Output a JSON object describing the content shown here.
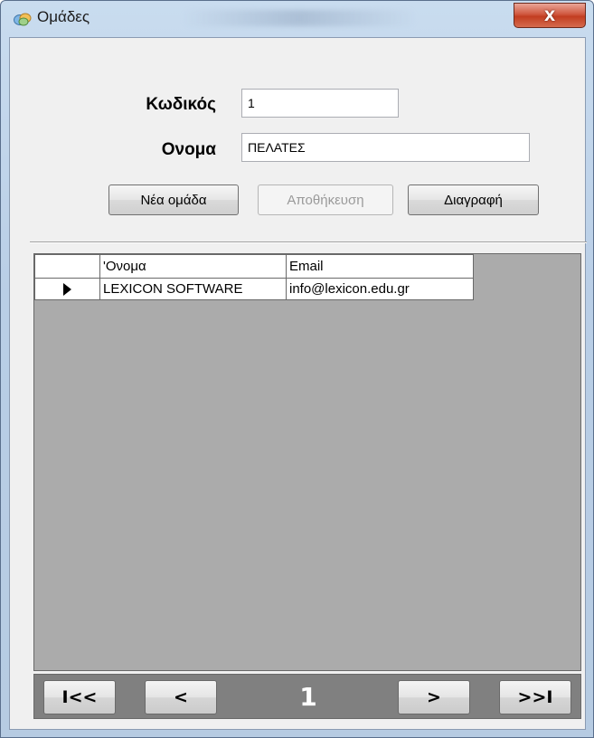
{
  "window": {
    "title": "Ομάδες",
    "close_glyph": "X"
  },
  "form": {
    "code_label": "Κωδικός",
    "code_value": "1",
    "name_label": "Ονομα",
    "name_value": "ΠΕΛΑΤΕΣ"
  },
  "buttons": {
    "new_group": "Νέα ομάδα",
    "save": "Αποθήκευση",
    "delete": "Διαγραφή"
  },
  "grid": {
    "columns": [
      "'Ονομα",
      "Email"
    ],
    "rows": [
      {
        "name": "LEXICON SOFTWARE",
        "email": "info@lexicon.edu.gr"
      }
    ]
  },
  "navigator": {
    "first": "I<<",
    "prev": "<",
    "page": "1",
    "next": ">",
    "last": ">>I"
  },
  "colors": {
    "title_gradient_top": "#c9dcef",
    "client_background": "#f0f0f0",
    "grid_background": "#ababab",
    "navigator_background": "#808080",
    "close_button": "#c23d21"
  }
}
